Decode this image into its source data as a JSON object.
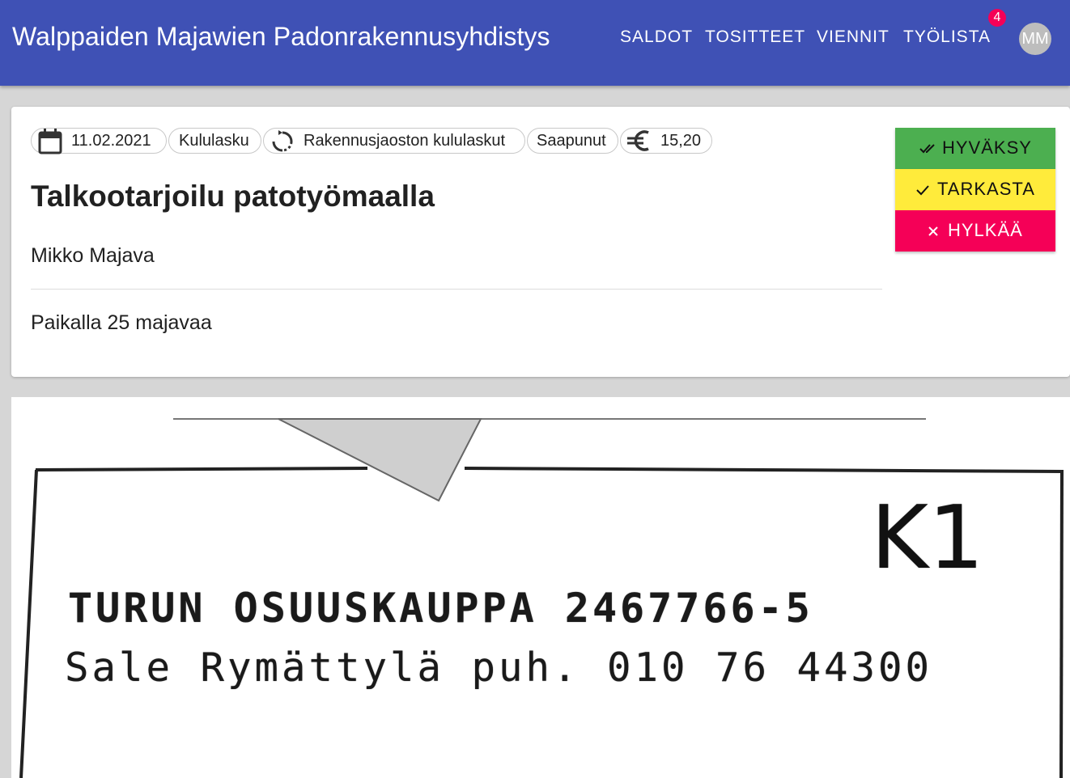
{
  "app": {
    "title": "Walppaiden Majawien Padonrakennusyhdistys",
    "nav": [
      "SALDOT",
      "TOSITTEET",
      "VIENNIT",
      "TYÖLISTA"
    ],
    "notification_count": "4",
    "avatar_initials": "MM"
  },
  "document": {
    "date": "11.02.2021",
    "type": "Kululasku",
    "workflow": "Rakennusjaoston kululaskut",
    "status": "Saapunut",
    "amount": "15,20",
    "title": "Talkootarjoilu patotyömaalla",
    "author": "Mikko Majava",
    "description": "Paikalla 25 majavaa"
  },
  "actions": {
    "approve": "HYVÄKSY",
    "inspect": "TARKASTA",
    "reject": "HYLKÄÄ"
  },
  "colors": {
    "appbar": "#3f51b5",
    "approve": "#4caf50",
    "inspect": "#ffeb3b",
    "reject": "#f50057"
  },
  "receipt": {
    "handwritten_mark": "K1",
    "line1": "TURUN OSUUSKAUPPA 2467766-5",
    "line2": "Sale Rymättylä puh. 010 76 44300"
  }
}
